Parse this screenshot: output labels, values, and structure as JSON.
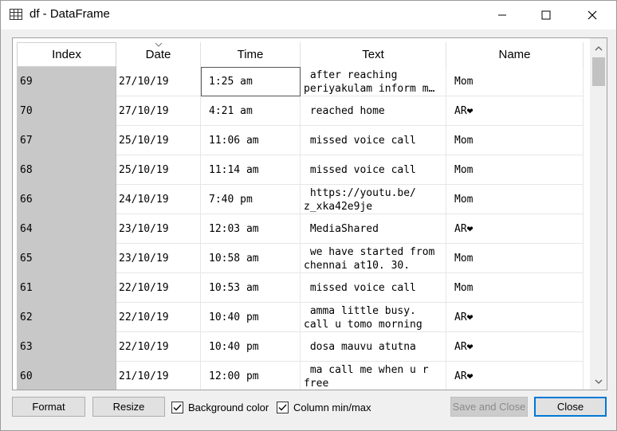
{
  "window": {
    "title": "df - DataFrame",
    "icon": "table-grid-icon"
  },
  "table": {
    "columns": [
      "Index",
      "Date",
      "Time",
      "Text",
      "Name"
    ],
    "sorted_column": "Date",
    "rows": [
      {
        "index": "69",
        "date": "27/10/19",
        "time": "1:25 am",
        "text": " after reaching\nperiyakulam inform m…",
        "name": "Mom"
      },
      {
        "index": "70",
        "date": "27/10/19",
        "time": "4:21 am",
        "text": " reached home",
        "name": "AR❤"
      },
      {
        "index": "67",
        "date": "25/10/19",
        "time": "11:06 am",
        "text": " missed voice call",
        "name": "Mom"
      },
      {
        "index": "68",
        "date": "25/10/19",
        "time": "11:14 am",
        "text": " missed voice call",
        "name": "Mom"
      },
      {
        "index": "66",
        "date": "24/10/19",
        "time": "7:40 pm",
        "text": " https://youtu.be/\nz_xka42e9je",
        "name": "Mom"
      },
      {
        "index": "64",
        "date": "23/10/19",
        "time": "12:03 am",
        "text": " MediaShared",
        "name": "AR❤"
      },
      {
        "index": "65",
        "date": "23/10/19",
        "time": "10:58 am",
        "text": " we have started from\nchennai at10. 30.",
        "name": "Mom"
      },
      {
        "index": "61",
        "date": "22/10/19",
        "time": "10:53 am",
        "text": " missed voice call",
        "name": "Mom"
      },
      {
        "index": "62",
        "date": "22/10/19",
        "time": "10:40 pm",
        "text": " amma little busy.\ncall u tomo morning",
        "name": "AR❤"
      },
      {
        "index": "63",
        "date": "22/10/19",
        "time": "10:40 pm",
        "text": " dosa mauvu atutna",
        "name": "AR❤"
      },
      {
        "index": "60",
        "date": "21/10/19",
        "time": "12:00 pm",
        "text": " ma call me when u r\nfree",
        "name": "AR❤"
      }
    ]
  },
  "buttons": {
    "format": "Format",
    "resize": "Resize",
    "save_close": "Save and Close",
    "close": "Close"
  },
  "checkboxes": {
    "background_color": {
      "label": "Background color",
      "checked": true
    },
    "column_minmax": {
      "label": "Column min/max",
      "checked": true
    }
  },
  "colors": {
    "index_bg": "#c8c8c8",
    "accent": "#0078d7"
  }
}
